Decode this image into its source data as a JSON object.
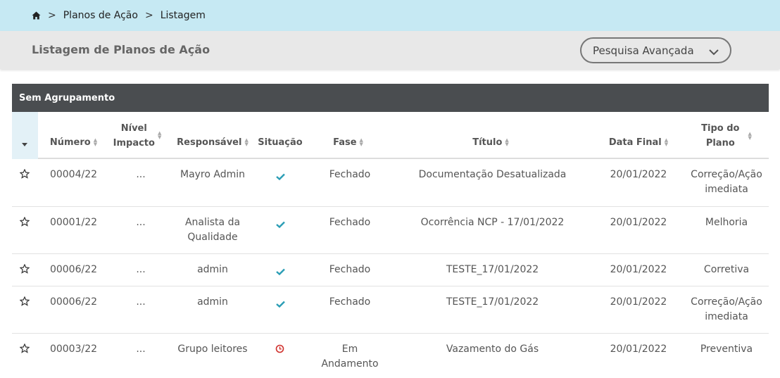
{
  "breadcrumb": {
    "sep": ">",
    "items": [
      "Planos de Ação",
      "Listagem"
    ]
  },
  "header": {
    "title": "Listagem de Planos de Ação",
    "search_button": "Pesquisa Avançada"
  },
  "group": {
    "label": "Sem Agrupamento"
  },
  "columns": {
    "numero": "Número",
    "nivel_impacto_1": "Nível",
    "nivel_impacto_2": "Impacto",
    "responsavel": "Responsável",
    "situacao": "Situação",
    "fase": "Fase",
    "titulo": "Título",
    "data_final": "Data Final",
    "tipo_1": "Tipo do",
    "tipo_2": "Plano"
  },
  "rows": [
    {
      "numero": "00004/22",
      "nivel": "...",
      "responsavel": "Mayro Admin",
      "responsavel2": "",
      "situacao": "check",
      "fase": "Fechado",
      "fase2": "",
      "titulo": "Documentação Desatualizada",
      "data_final": "20/01/2022",
      "tipo": "Correção/Ação",
      "tipo2": "imediata"
    },
    {
      "numero": "00001/22",
      "nivel": "...",
      "responsavel": "Analista da",
      "responsavel2": "Qualidade",
      "situacao": "check",
      "fase": "Fechado",
      "fase2": "",
      "titulo": "Ocorrência NCP - 17/01/2022",
      "data_final": "20/01/2022",
      "tipo": "Melhoria",
      "tipo2": ""
    },
    {
      "numero": "00006/22",
      "nivel": "...",
      "responsavel": "admin",
      "responsavel2": "",
      "situacao": "check",
      "fase": "Fechado",
      "fase2": "",
      "titulo": "TESTE_17/01/2022",
      "data_final": "20/01/2022",
      "tipo": "Corretiva",
      "tipo2": ""
    },
    {
      "numero": "00006/22",
      "nivel": "...",
      "responsavel": "admin",
      "responsavel2": "",
      "situacao": "check",
      "fase": "Fechado",
      "fase2": "",
      "titulo": "TESTE_17/01/2022",
      "data_final": "20/01/2022",
      "tipo": "Correção/Ação",
      "tipo2": "imediata"
    },
    {
      "numero": "00003/22",
      "nivel": "...",
      "responsavel": "Grupo leitores",
      "responsavel2": "",
      "situacao": "clock",
      "fase": "Em",
      "fase2": "Andamento",
      "titulo": "Vazamento do Gás",
      "data_final": "20/01/2022",
      "tipo": "Preventiva",
      "tipo2": ""
    }
  ],
  "colors": {
    "check": "#2a9db5",
    "clock": "#d0312d",
    "group_bg": "#4a4d50",
    "breadcrumb_bg": "#c6e9f3"
  }
}
